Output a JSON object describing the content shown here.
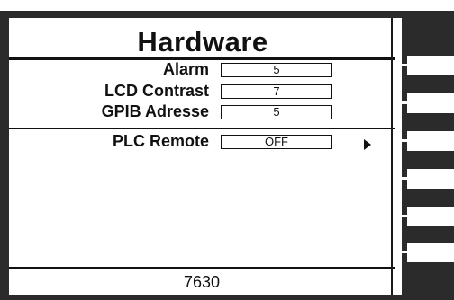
{
  "screen": {
    "title": "Hardware",
    "rows": [
      {
        "label": "Alarm",
        "value": "5"
      },
      {
        "label": "LCD Contrast",
        "value": "7"
      },
      {
        "label": "GPIB Adresse",
        "value": "5"
      },
      {
        "label": "PLC Remote",
        "value": "OFF"
      }
    ],
    "footer": "7630",
    "submenu_arrow_icon": "triangle-right-icon"
  },
  "softkeys": [
    "",
    "",
    "",
    "",
    "",
    ""
  ]
}
